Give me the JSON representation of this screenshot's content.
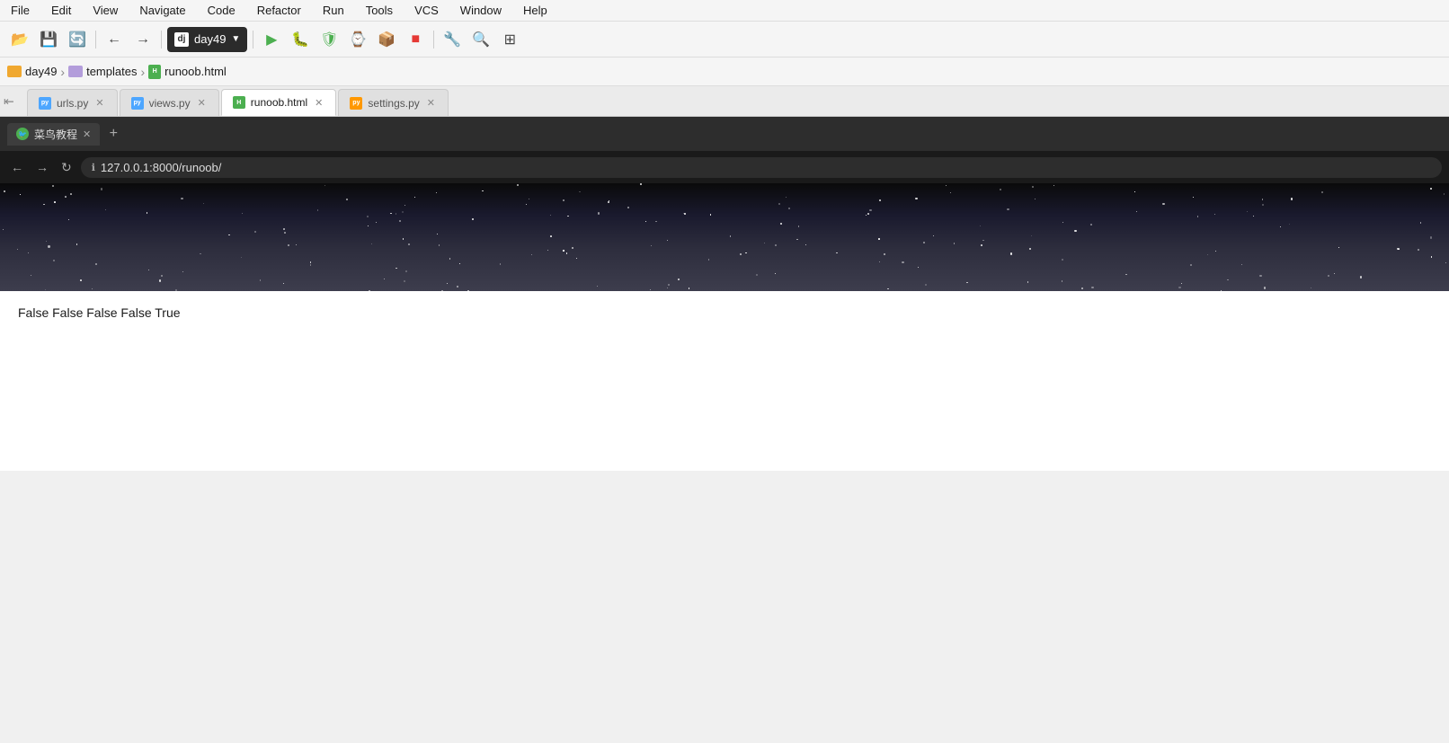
{
  "menu": {
    "items": [
      "File",
      "Edit",
      "View",
      "Navigate",
      "Code",
      "Refactor",
      "Run",
      "Tools",
      "VCS",
      "Window",
      "Help"
    ]
  },
  "toolbar": {
    "project_name": "day49",
    "dj_label": "dj"
  },
  "breadcrumb": {
    "items": [
      {
        "name": "day49",
        "type": "folder-yellow"
      },
      {
        "name": "templates",
        "type": "folder-purple"
      },
      {
        "name": "runoob.html",
        "type": "file-html"
      }
    ]
  },
  "tabs": [
    {
      "id": "urls",
      "label": "urls.py",
      "type": "py",
      "active": false
    },
    {
      "id": "views",
      "label": "views.py",
      "type": "py",
      "active": false
    },
    {
      "id": "runoob",
      "label": "runoob.html",
      "type": "html",
      "active": true
    },
    {
      "id": "settings",
      "label": "settings.py",
      "type": "py",
      "active": false
    }
  ],
  "browser": {
    "tab_title": "菜鸟教程",
    "favicon": "🐦",
    "url": "127.0.0.1:8000/runoob/",
    "new_tab_label": "+",
    "nav": {
      "back": "←",
      "forward": "→",
      "refresh": "↻"
    },
    "content_text": "False False False False True"
  }
}
